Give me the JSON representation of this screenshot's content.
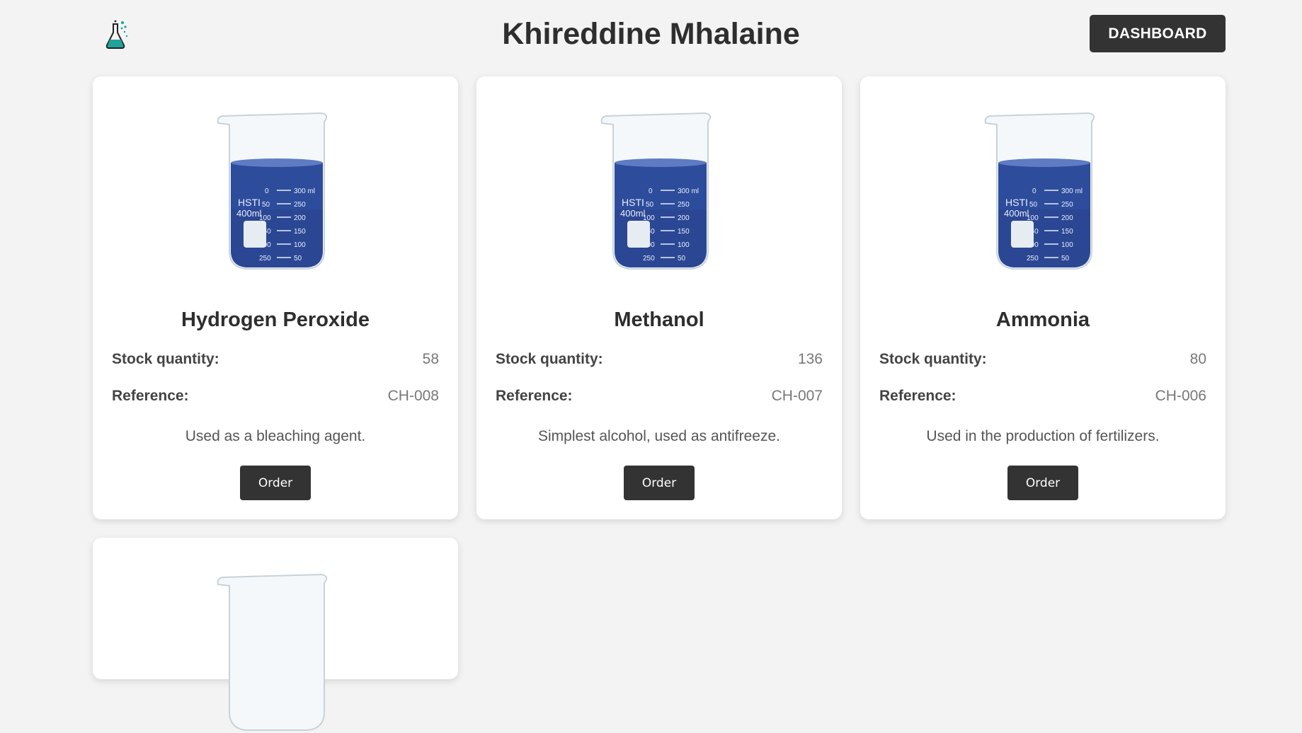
{
  "header": {
    "title": "Khireddine Mhalaine",
    "dashboard_label": "DASHBOARD",
    "logo_icon": "flask-icon"
  },
  "labels": {
    "stock": "Stock quantity:",
    "reference": "Reference:",
    "order": "Order"
  },
  "products": [
    {
      "name": "Hydrogen Peroxide",
      "stock": "58",
      "reference": "CH-008",
      "description": "Used as a bleaching agent.",
      "image_icon": "beaker-image"
    },
    {
      "name": "Methanol",
      "stock": "136",
      "reference": "CH-007",
      "description": "Simplest alcohol, used as antifreeze.",
      "image_icon": "beaker-image"
    },
    {
      "name": "Ammonia",
      "stock": "80",
      "reference": "CH-006",
      "description": "Used in the production of fertilizers.",
      "image_icon": "beaker-image"
    }
  ],
  "colors": {
    "background": "#f3f3f3",
    "button": "#333333",
    "liquid": "#2a4a9a",
    "logo_teal": "#1fa39a"
  }
}
